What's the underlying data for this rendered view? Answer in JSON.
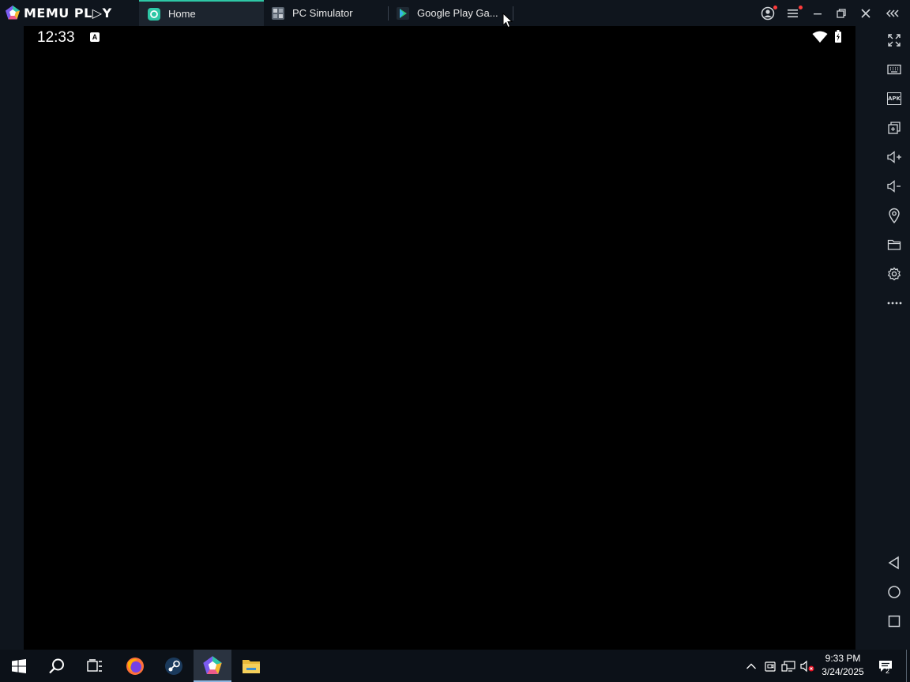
{
  "app": {
    "logo_text": "MEMU PL▷Y",
    "tabs": [
      {
        "label": "Home"
      },
      {
        "label": "PC Simulator"
      },
      {
        "label": "Google Play Ga..."
      }
    ]
  },
  "android": {
    "status_time": "12:33",
    "status_notification": "A"
  },
  "sidebar": {
    "apk_label": "APK"
  },
  "taskbar": {
    "time": "9:33 PM",
    "date": "3/24/2025",
    "notification_count": "2"
  },
  "colors": {
    "accent": "#2ec7a6",
    "background": "#0f151d",
    "screen": "#000000"
  }
}
